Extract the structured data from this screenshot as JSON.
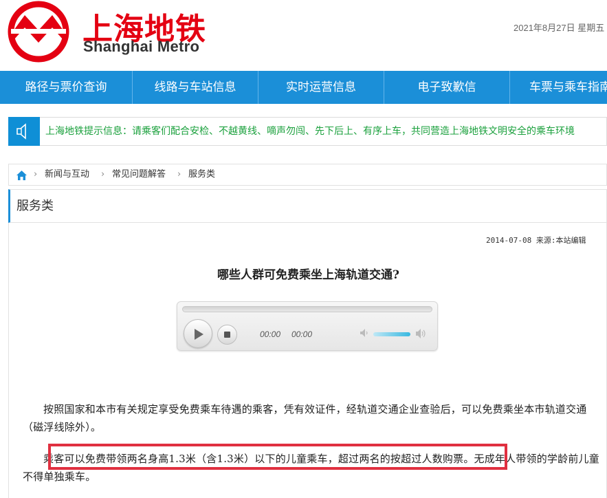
{
  "header": {
    "logo_title": "上海地铁",
    "logo_subtitle": "Shanghai Metro",
    "date": "2021年8月27日 星期五"
  },
  "nav": {
    "items": [
      {
        "label": "路径与票价查询"
      },
      {
        "label": "线路与车站信息"
      },
      {
        "label": "实时运营信息"
      },
      {
        "label": "电子致歉信"
      },
      {
        "label": "车票与乘车指南"
      }
    ]
  },
  "notice": {
    "text": "上海地铁提示信息：请乘客们配合安检、不越黄线、嘀声勿闯、先下后上、有序上车，共同营造上海地铁文明安全的乘车环境"
  },
  "breadcrumb": {
    "items": [
      "新闻与互动",
      "常见问题解答",
      "服务类"
    ],
    "separator": "›"
  },
  "section": {
    "title": "服务类"
  },
  "article": {
    "meta": "2014-07-08 来源:本站编辑",
    "title": "哪些人群可免费乘坐上海轨道交通?",
    "paragraph1": "按照国家和本市有关规定享受免费乘车待遇的乘客，凭有效证件，经轨道交通企业查验后，可以免费乘坐本市轨道交通（磁浮线除外）。",
    "paragraph2": "乘客可以免费带领两名身高1.3米（含1.3米）以下的儿童乘车，超过两名的按超过人数购票。无成年人带领的学龄前儿童不得单独乘车。"
  },
  "player": {
    "current_time": "00:00",
    "duration": "00:00"
  },
  "colors": {
    "brand_red": "#e40012",
    "nav_blue": "#1b8fd8",
    "notice_green": "#1aa03c",
    "highlight_red": "#e03040"
  }
}
